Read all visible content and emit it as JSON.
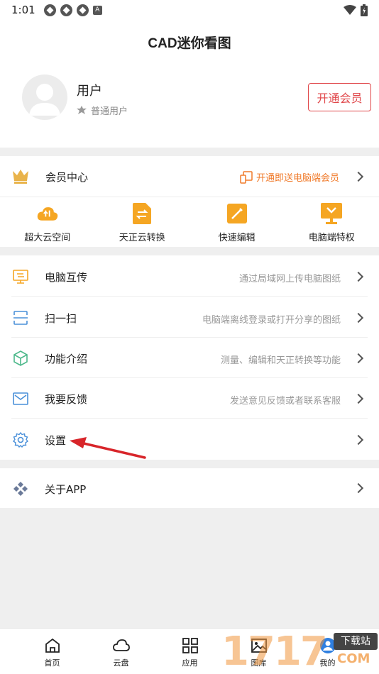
{
  "status_bar": {
    "time": "1:01"
  },
  "header": {
    "title": "CAD迷你看图"
  },
  "profile": {
    "name": "用户",
    "level": "普通用户",
    "vip_button": "开通会员"
  },
  "member": {
    "title": "会员中心",
    "promo": "开通即送电脑端会员",
    "features": [
      {
        "label": "超大云空间",
        "icon": "cloud-icon",
        "color": "#f5a623"
      },
      {
        "label": "天正云转换",
        "icon": "convert-doc-icon",
        "color": "#f5a623"
      },
      {
        "label": "快速编辑",
        "icon": "edit-pen-icon",
        "color": "#f5a623"
      },
      {
        "label": "电脑端特权",
        "icon": "computer-icon",
        "color": "#f5a623"
      }
    ]
  },
  "menu": [
    {
      "label": "电脑互传",
      "desc": "通过局域网上传电脑图纸",
      "icon": "monitor-transfer-icon"
    },
    {
      "label": "扫一扫",
      "desc": "电脑端离线登录或打开分享的图纸",
      "icon": "scan-icon"
    },
    {
      "label": "功能介绍",
      "desc": "测量、编辑和天正转换等功能",
      "icon": "cube-icon"
    },
    {
      "label": "我要反馈",
      "desc": "发送意见反馈或者联系客服",
      "icon": "mail-icon"
    },
    {
      "label": "设置",
      "desc": "",
      "icon": "gear-icon"
    }
  ],
  "about": {
    "label": "关于APP",
    "icon": "diamond-icon"
  },
  "bottom_nav": [
    {
      "label": "首页",
      "icon": "home-icon"
    },
    {
      "label": "云盘",
      "icon": "cloud-outline-icon"
    },
    {
      "label": "应用",
      "icon": "grid-icon"
    },
    {
      "label": "图库",
      "icon": "image-icon"
    },
    {
      "label": "我的",
      "icon": "user-icon"
    }
  ],
  "watermark": {
    "digits": "1717",
    "badge": "下载站",
    "domain": "COM"
  },
  "colors": {
    "accent_red": "#e0474a",
    "accent_orange": "#f07a2a",
    "feature_yellow": "#f5a623"
  }
}
